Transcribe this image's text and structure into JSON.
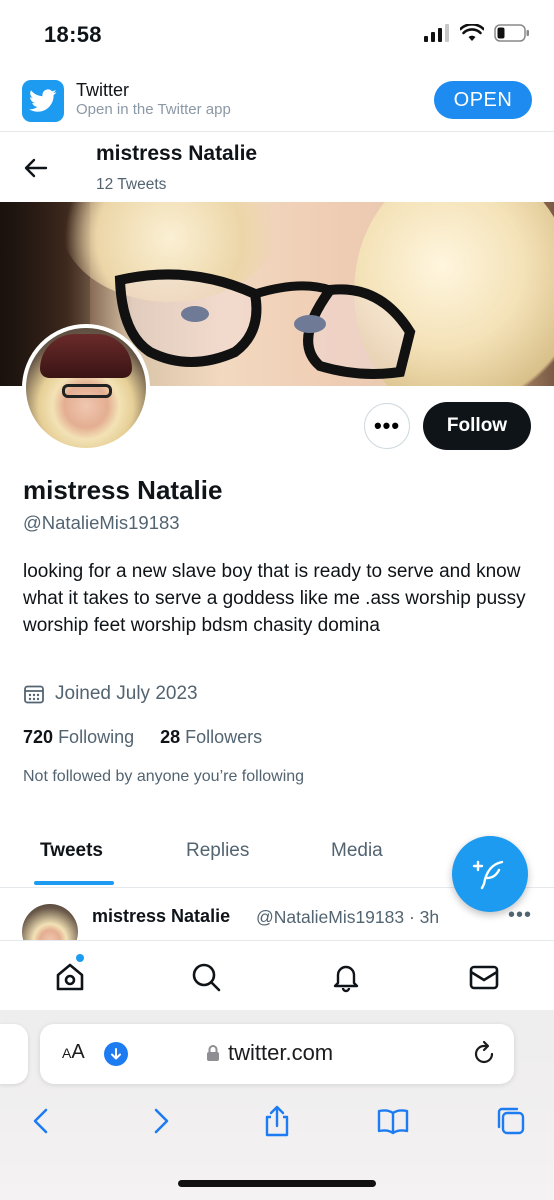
{
  "status_bar": {
    "time": "18:58"
  },
  "app_banner": {
    "name": "Twitter",
    "subtitle": "Open in the Twitter app",
    "open_label": "OPEN"
  },
  "header": {
    "name": "mistress Natalie",
    "tweet_count": "12 Tweets"
  },
  "profile": {
    "display_name": "mistress Natalie",
    "handle": "@NatalieMis19183",
    "bio": "looking for a new slave boy that is ready to serve and know what it takes to serve a goddess like me .ass worship pussy worship feet worship bdsm chasity domina",
    "joined": "Joined July 2023",
    "following_count": "720",
    "following_label": "Following",
    "followers_count": "28",
    "followers_label": "Followers",
    "not_followed": "Not followed by anyone you’re following",
    "follow_label": "Follow",
    "more_label": "•••"
  },
  "tabs": [
    {
      "label": "Tweets",
      "active": true
    },
    {
      "label": "Replies",
      "active": false
    },
    {
      "label": "Media",
      "active": false
    }
  ],
  "tweet_preview": {
    "name": "mistress Natalie",
    "meta": "@NatalieMis19183 · 3h",
    "more": "•••"
  },
  "safari": {
    "aa_big": "A",
    "aa_small": "A",
    "url": "twitter.com"
  },
  "colors": {
    "accent": "#1d9bf0",
    "text_primary": "#0f1419",
    "text_secondary": "#536471"
  },
  "icons": {
    "status": [
      "signal-icon",
      "wifi-icon",
      "battery-icon"
    ],
    "nav": [
      "home-icon",
      "search-icon",
      "bell-icon",
      "mail-icon"
    ],
    "safari_toolbar": [
      "back-icon",
      "forward-icon",
      "share-icon",
      "bookmarks-icon",
      "tabs-icon"
    ]
  }
}
